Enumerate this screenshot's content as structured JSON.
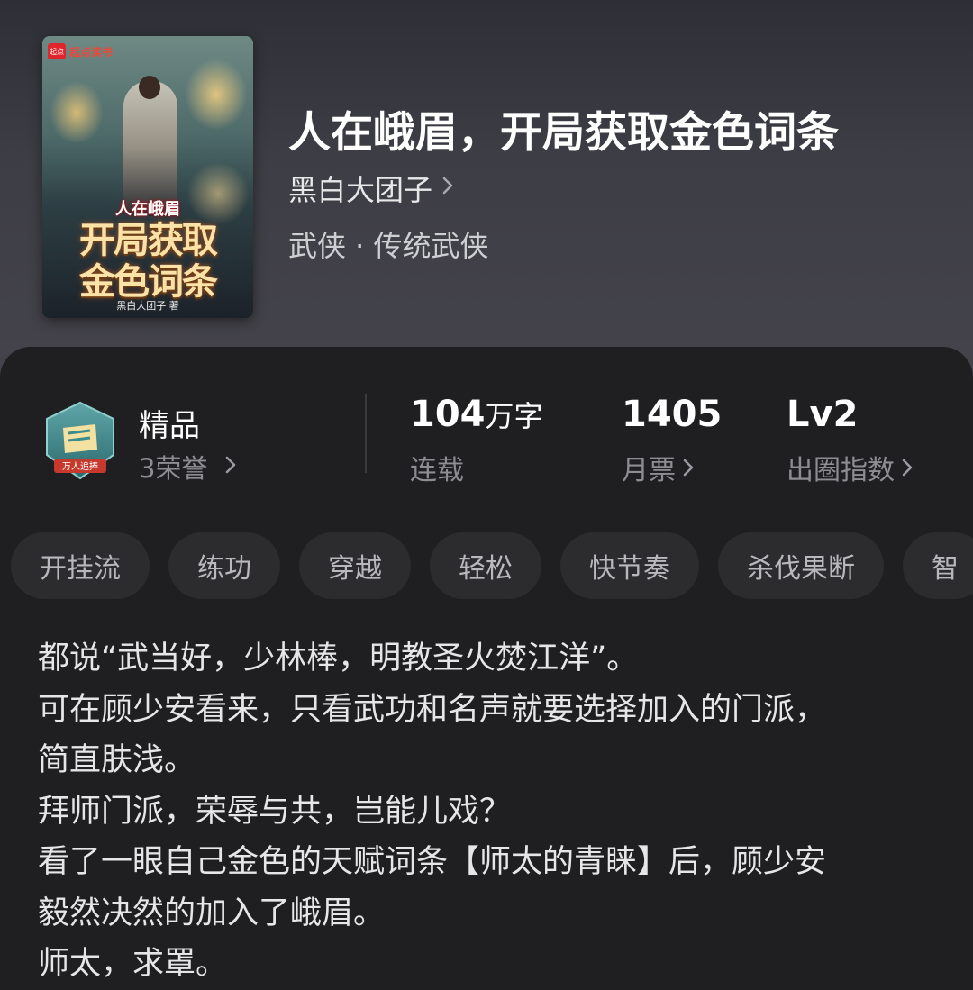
{
  "book": {
    "title": "人在峨眉，开局获取金色词条",
    "author": "黑白大团子",
    "genre": "武侠 · 传统武侠",
    "cover": {
      "publisher": "起点读书",
      "publisher_mark": "起点",
      "title_small": "人在峨眉",
      "title_line1": "开局获取",
      "title_line2": "金色词条",
      "author_credit": "黑白大团子 著"
    }
  },
  "stats": {
    "quality": {
      "label": "精品",
      "honor": "3荣誉",
      "badge_text": "万人追捧"
    },
    "words": {
      "value": "104",
      "unit": "万字",
      "label": "连载"
    },
    "monthly_votes": {
      "value": "1405",
      "label": "月票"
    },
    "breakout": {
      "value": "Lv2",
      "label": "出圈指数"
    }
  },
  "tags": [
    "开挂流",
    "练功",
    "穿越",
    "轻松",
    "快节奏",
    "杀伐果断",
    "智"
  ],
  "synopsis": [
    "都说“武当好，少林棒，明教圣火焚江洋”。",
    "可在顾少安看来，只看武功和名声就要选择加入的门派，",
    "简直肤浅。",
    "拜师门派，荣辱与共，岂能儿戏？",
    "看了一眼自己金色的天赋词条【师太的青睐】后，顾少安",
    "毅然决然的加入了峨眉。",
    "师太，求罩。"
  ],
  "icons": {
    "chevron": "chevron-right-icon",
    "badge": "shield-flag-badge-icon"
  },
  "colors": {
    "panel": "#1f1f21",
    "tag_bg": "#2c2c2f",
    "muted": "#8d8d92"
  }
}
